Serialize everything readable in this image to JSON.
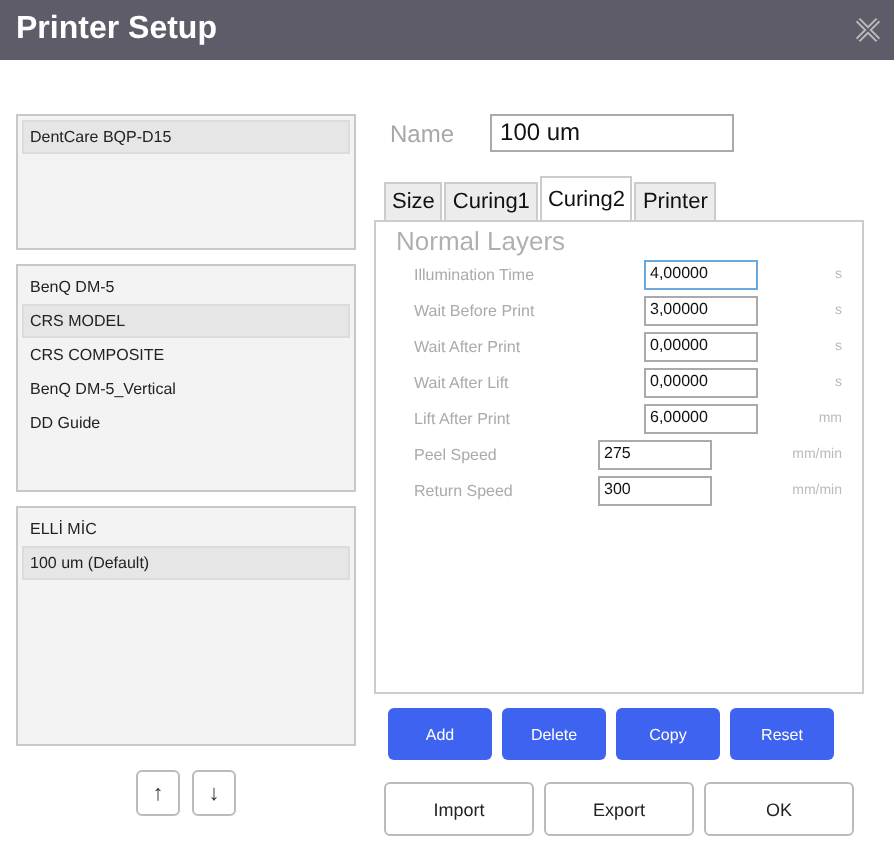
{
  "window": {
    "title": "Printer Setup"
  },
  "lists": [
    {
      "items": [
        {
          "label": "DentCare BQP-D15",
          "selected": true
        }
      ]
    },
    {
      "items": [
        {
          "label": "BenQ DM-5",
          "selected": false
        },
        {
          "label": "CRS MODEL",
          "selected": true
        },
        {
          "label": "CRS COMPOSITE",
          "selected": false
        },
        {
          "label": "BenQ DM-5_Vertical",
          "selected": false
        },
        {
          "label": "DD Guide",
          "selected": false
        }
      ]
    },
    {
      "items": [
        {
          "label": "ELLİ MİC",
          "selected": false
        },
        {
          "label": "100 um (Default)",
          "selected": true
        }
      ]
    }
  ],
  "move_buttons": [
    "↑",
    "↓"
  ],
  "name": {
    "label": "Name",
    "value": "100 um"
  },
  "tabs": [
    {
      "label": "Size",
      "selected": false
    },
    {
      "label": "Curing1",
      "selected": false
    },
    {
      "label": "Curing2",
      "selected": true
    },
    {
      "label": "Printer",
      "selected": false
    }
  ],
  "section": {
    "title": "Normal Layers",
    "fields": [
      {
        "label": "Illumination Time",
        "value": "4,00000",
        "unit": "s",
        "kind": "narrow",
        "focused": true
      },
      {
        "label": "Wait Before Print",
        "value": "3,00000",
        "unit": "s",
        "kind": "narrow",
        "focused": false
      },
      {
        "label": "Wait After Print",
        "value": "0,00000",
        "unit": "s",
        "kind": "narrow",
        "focused": false
      },
      {
        "label": "Wait After Lift",
        "value": "0,00000",
        "unit": "s",
        "kind": "narrow",
        "focused": false
      },
      {
        "label": "Lift After Print",
        "value": "6,00000",
        "unit": "mm",
        "kind": "narrow",
        "focused": false
      },
      {
        "label": "Peel Speed",
        "value": "275",
        "unit": "mm/min",
        "kind": "wide",
        "focused": false
      },
      {
        "label": "Return Speed",
        "value": "300",
        "unit": "mm/min",
        "kind": "wide",
        "focused": false
      }
    ]
  },
  "action_buttons": [
    "Add",
    "Delete",
    "Copy",
    "Reset"
  ],
  "footer_buttons": [
    "Import",
    "Export",
    "OK"
  ]
}
